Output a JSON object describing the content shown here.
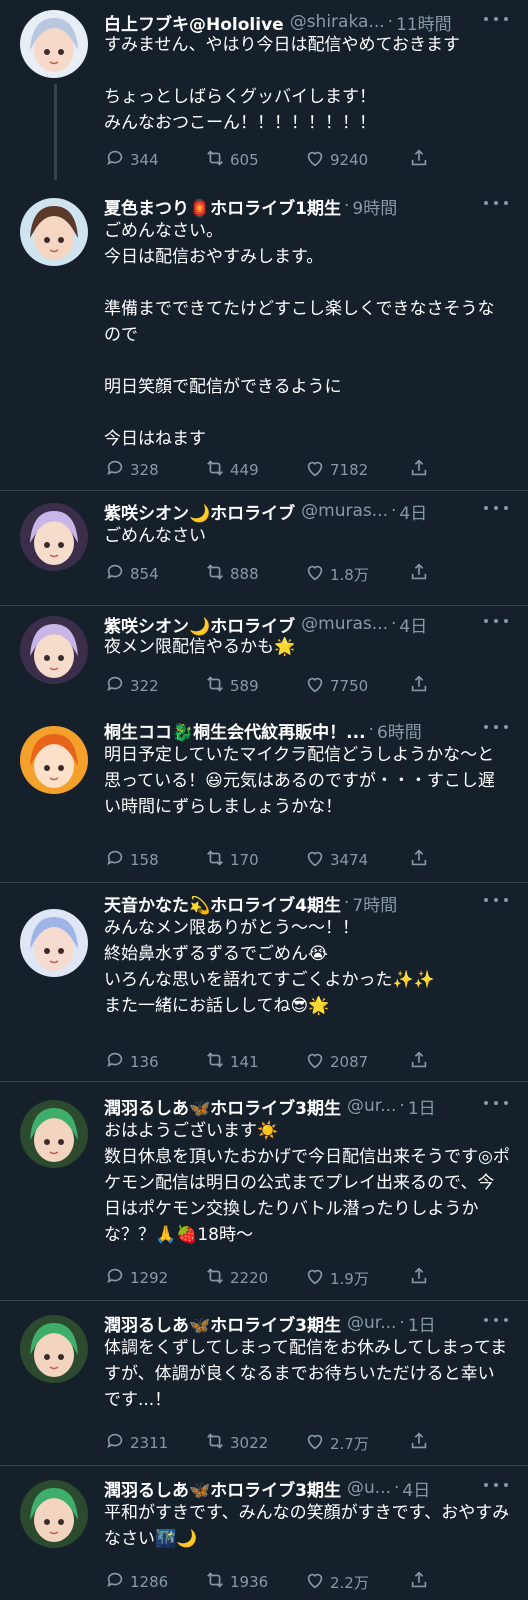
{
  "tweets": [
    {
      "name": "白上フブキ@Hololive",
      "handle": "@shiraka...",
      "time": "11時間",
      "text": "すみません、やはり今日は配信やめておきます\n\nちょっとしばらくグッバイします！\nみんなおつこーん！！！！！！！！",
      "replies": "344",
      "retweets": "605",
      "likes": "9240",
      "avatar_colors": [
        "#e8eef6",
        "#b7c7de",
        "#f6d9c8"
      ]
    },
    {
      "name": "夏色まつり🏮ホロライブ1期生",
      "handle": "",
      "time": "9時間",
      "text": "ごめんなさい。\n今日は配信おやすみします。\n\n準備までできてたけどすこし楽しくできなさそうなので\n\n明日笑顔で配信ができるように\n\n今日はねます",
      "replies": "328",
      "retweets": "449",
      "likes": "7182",
      "avatar_colors": [
        "#cfe3f0",
        "#5b3a2a",
        "#f4d6c2"
      ]
    },
    {
      "name": "紫咲シオン🌙ホロライブ",
      "handle": "@muras...",
      "time": "4日",
      "text": "ごめんなさい",
      "replies": "854",
      "retweets": "888",
      "likes": "1.8万",
      "avatar_colors": [
        "#3a2e4a",
        "#c9b6e8",
        "#f5dccb"
      ]
    },
    {
      "name": "紫咲シオン🌙ホロライブ",
      "handle": "@muras...",
      "time": "4日",
      "text": "夜メン限配信やるかも🌟",
      "replies": "322",
      "retweets": "589",
      "likes": "7750",
      "avatar_colors": [
        "#3a2e4a",
        "#c9b6e8",
        "#f5dccb"
      ]
    },
    {
      "name": "桐生ココ🐉桐生会代紋再販中！...",
      "handle": "",
      "time": "6時間",
      "text": "明日予定していたマイクラ配信どうしようかな〜と思っている！😃元気はあるのですが・・・すこし遅い時間にずらしましょうかな！",
      "replies": "158",
      "retweets": "170",
      "likes": "3474",
      "avatar_colors": [
        "#f4a12c",
        "#e8641b",
        "#fde0c8"
      ]
    },
    {
      "name": "天音かなた💫ホロライブ4期生",
      "handle": "",
      "time": "7時間",
      "text": "みんなメン限ありがとう〜〜！！\n終始鼻水ずるずるでごめん😭\nいろんな思いを語れてすごくよかった✨✨\nまた一緒にお話ししてね😎🌟",
      "replies": "136",
      "retweets": "141",
      "likes": "2087",
      "avatar_colors": [
        "#dfe6f5",
        "#9fb4e6",
        "#f6dcd0"
      ]
    },
    {
      "name": "潤羽るしあ🦋ホロライブ3期生",
      "handle": "@ur...",
      "time": "1日",
      "text": "おはようございます☀️\n数日休息を頂いたおかげで今日配信出来そうです◎ポケモン配信は明日の公式までプレイ出来るので、今日はポケモン交換したりバトル潜ったりしようかな？？🙏🍓18時〜",
      "replies": "1292",
      "retweets": "2220",
      "likes": "1.9万",
      "avatar_colors": [
        "#2c4a2e",
        "#3fae6a",
        "#f3d4c0"
      ]
    },
    {
      "name": "潤羽るしあ🦋ホロライブ3期生",
      "handle": "@ur...",
      "time": "1日",
      "text": "体調をくずしてしまって配信をお休みしてしまってますが、体調が良くなるまでお待ちいただけると幸いです...！",
      "replies": "2311",
      "retweets": "3022",
      "likes": "2.7万",
      "avatar_colors": [
        "#2c4a2e",
        "#3fae6a",
        "#f3d4c0"
      ]
    },
    {
      "name": "潤羽るしあ🦋ホロライブ3期生",
      "handle": "@u...",
      "time": "4日",
      "text": "平和がすきです、みんなの笑顔がすきです、おやすみなさい🌃🌙",
      "replies": "1286",
      "retweets": "1936",
      "likes": "2.2万",
      "avatar_colors": [
        "#2c4a2e",
        "#3fae6a",
        "#f3d4c0"
      ]
    }
  ],
  "colors": {
    "background": "#15202b",
    "text": "#ffffff",
    "secondary": "#8899a6",
    "divider": "#38444d"
  }
}
